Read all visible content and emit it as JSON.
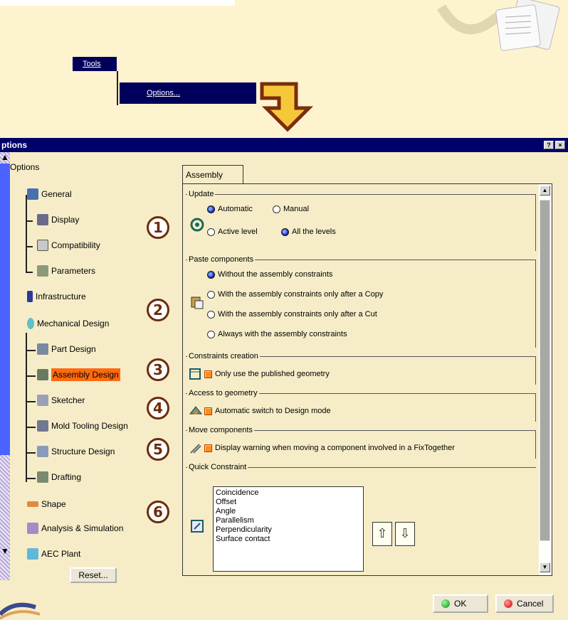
{
  "menu": {
    "tools_label": "Tools",
    "options_label": "Options..."
  },
  "dialog": {
    "title": "ptions",
    "tree": {
      "items": [
        {
          "label": "Options"
        },
        {
          "label": "General"
        },
        {
          "label": "Display"
        },
        {
          "label": "Compatibility"
        },
        {
          "label": "Parameters"
        },
        {
          "label": "Infrastructure"
        },
        {
          "label": "Mechanical Design"
        },
        {
          "label": "Part Design"
        },
        {
          "label": "Assembly Design"
        },
        {
          "label": "Sketcher"
        },
        {
          "label": "Mold Tooling Design"
        },
        {
          "label": "Structure Design"
        },
        {
          "label": "Drafting"
        },
        {
          "label": "Shape"
        },
        {
          "label": "Analysis & Simulation"
        },
        {
          "label": "AEC Plant"
        }
      ],
      "reset_label": "Reset..."
    },
    "tab_label": "Assembly",
    "update": {
      "title": "Update",
      "automatic": "Automatic",
      "manual": "Manual",
      "active_level": "Active level",
      "all_levels": "All the levels"
    },
    "paste": {
      "title": "Paste components",
      "opt1": "Without the assembly constraints",
      "opt2": "With the assembly constraints only after a Copy",
      "opt3": "With the assembly constraints only after a Cut",
      "opt4": "Always with the assembly constraints"
    },
    "constraints": {
      "title": "Constraints creation",
      "opt": "Only use the published geometry"
    },
    "access": {
      "title": "Access to geometry",
      "opt": "Automatic switch to Design mode"
    },
    "move": {
      "title": "Move components",
      "opt": "Display warning when moving a component involved in a FixTogether"
    },
    "quick": {
      "title": "Quick Constraint",
      "items": [
        "Coincidence",
        "Offset",
        "Angle",
        "Parallelism",
        "Perpendicularity",
        "Surface contact"
      ]
    },
    "ok_label": "OK",
    "cancel_label": "Cancel"
  },
  "callouts": [
    "1",
    "2",
    "3",
    "4",
    "5",
    "6"
  ],
  "colors": {
    "background": "#fdf3cf",
    "titlebar": "#00006a",
    "menu_highlight": "#00005c",
    "tree_highlight": "#ff6a10",
    "callout": "#6b2c0c",
    "arrow": "#7a2e0a"
  }
}
